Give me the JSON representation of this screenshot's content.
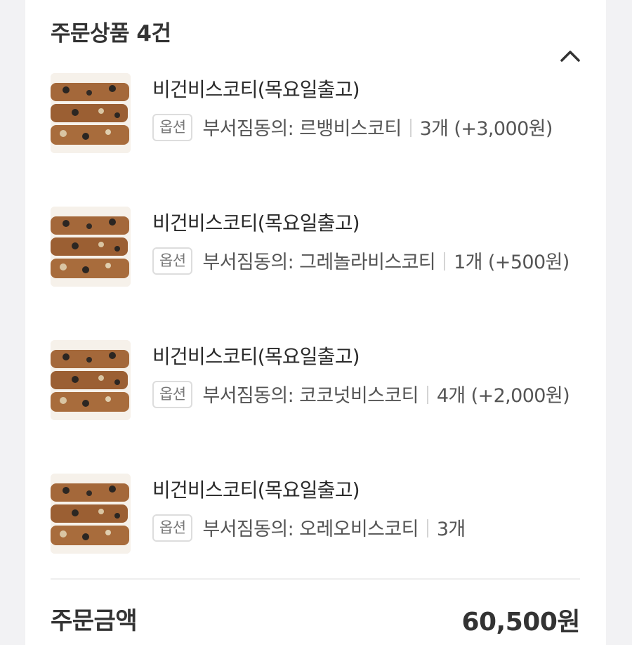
{
  "order": {
    "header_title": "주문상품 4건",
    "collapse_icon": "chevron-up-icon",
    "items": [
      {
        "name": "비건비스코티(목요일출고)",
        "badge": "옵션",
        "option": "부서짐동의: 르뱅비스코티",
        "quantity": "3개",
        "price_extra": "(+3,000원)"
      },
      {
        "name": "비건비스코티(목요일출고)",
        "badge": "옵션",
        "option": "부서짐동의: 그레놀라비스코티",
        "quantity": "1개",
        "price_extra": "(+500원)"
      },
      {
        "name": "비건비스코티(목요일출고)",
        "badge": "옵션",
        "option": "부서짐동의: 코코넛비스코티",
        "quantity": "4개",
        "price_extra": "(+2,000원)"
      },
      {
        "name": "비건비스코티(목요일출고)",
        "badge": "옵션",
        "option": "부서짐동의: 오레오비스코티",
        "quantity": "3개",
        "price_extra": ""
      }
    ],
    "total_label": "주문금액",
    "total_amount": "60,500원"
  },
  "colors": {
    "background": "#f2f2f4",
    "card": "#ffffff",
    "text": "#333333",
    "muted": "#555555",
    "badge_border": "#dddddd"
  }
}
